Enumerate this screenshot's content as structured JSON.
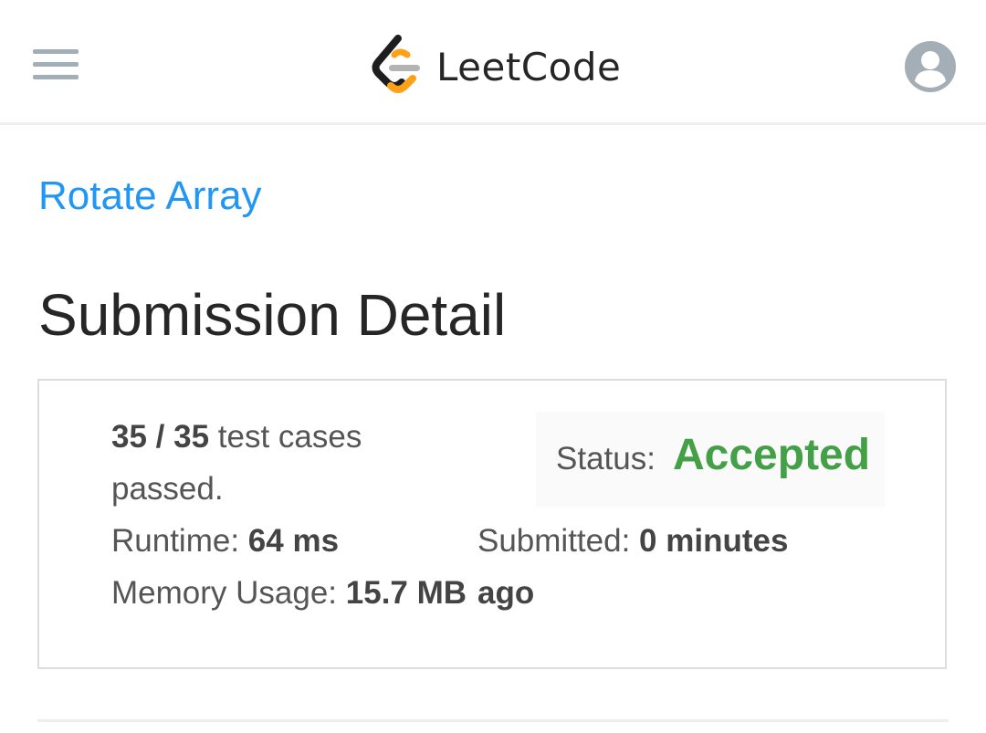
{
  "header": {
    "logo_text": "LeetCode",
    "menu_icon": "hamburger-menu-icon",
    "avatar_icon": "user-avatar-icon",
    "logo_colors": {
      "bracket": "#1e1e1e",
      "accent": "#ffa116",
      "bar": "#b3b3b3"
    }
  },
  "problem": {
    "title": "Rotate Array"
  },
  "page": {
    "title": "Submission Detail"
  },
  "submission": {
    "test_cases": "35 / 35",
    "test_cases_suffix": "test cases",
    "passed_label": "passed.",
    "runtime_label": "Runtime:",
    "runtime_value": "64 ms",
    "memory_label": "Memory Usage:",
    "memory_value": "15.7 MB",
    "status_label": "Status:",
    "status_value": "Accepted",
    "submitted_label": "Submitted:",
    "submitted_value": "0 minutes",
    "submitted_suffix": "ago"
  },
  "colors": {
    "link": "#2196f3",
    "accepted": "#43a047",
    "text": "#555555",
    "title": "#262626"
  }
}
